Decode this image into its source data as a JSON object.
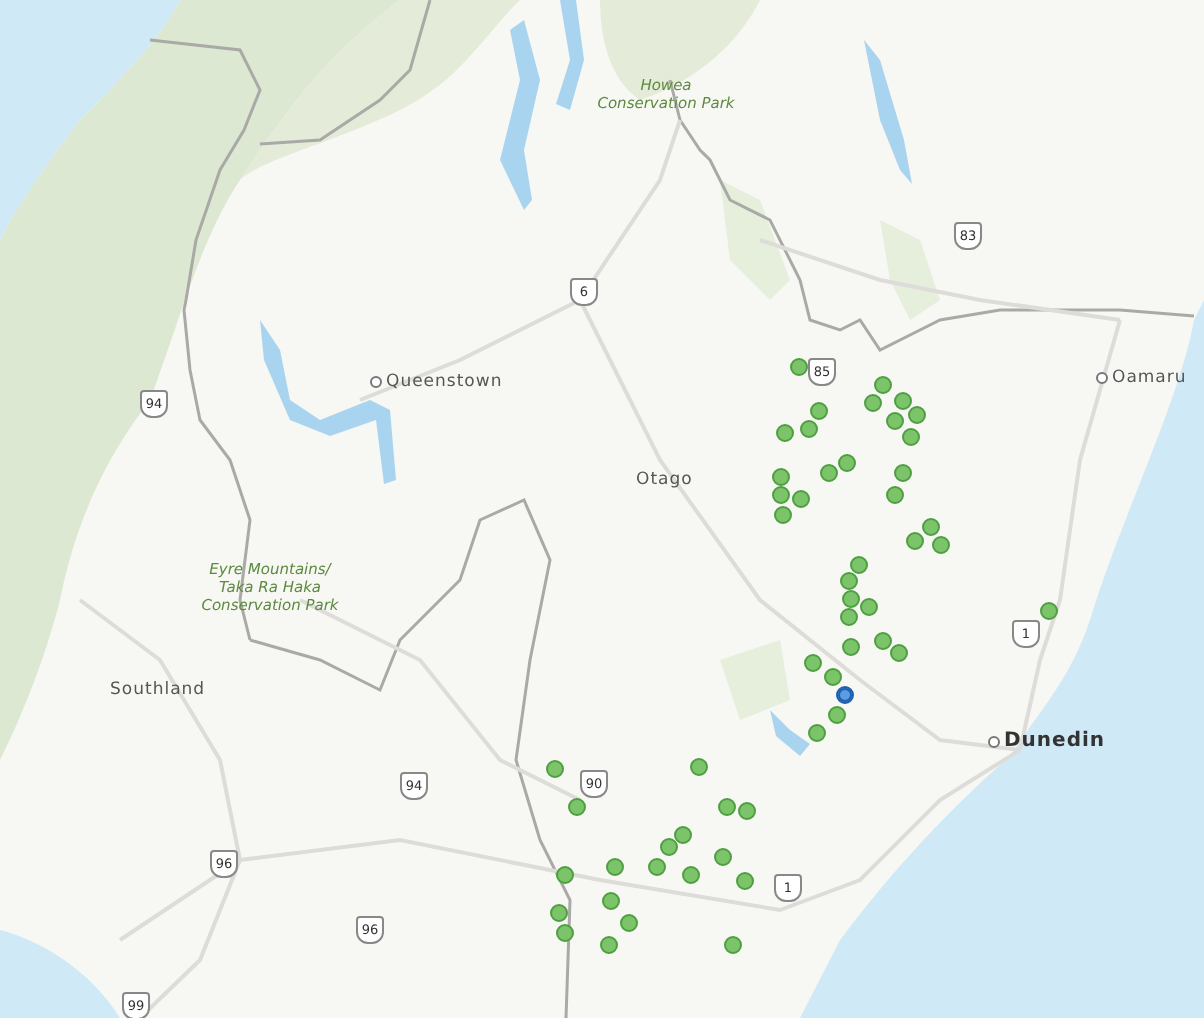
{
  "map": {
    "places": [
      {
        "name": "Queenstown",
        "kind": "town"
      },
      {
        "name": "Otago",
        "kind": "region"
      },
      {
        "name": "Oamaru",
        "kind": "town"
      },
      {
        "name": "Southland",
        "kind": "region"
      },
      {
        "name": "Dunedin",
        "kind": "city"
      },
      {
        "name": "Howea Conservation Park",
        "kind": "park"
      },
      {
        "name": "Eyre Mountains/ Taka Ra Haka Conservation Park",
        "kind": "park"
      }
    ],
    "shields": [
      "6",
      "94",
      "83",
      "85",
      "94",
      "90",
      "96",
      "96",
      "99",
      "1",
      "1"
    ],
    "markers": [
      {
        "selected": false
      },
      {
        "selected": false
      },
      {
        "selected": false
      },
      {
        "selected": false
      },
      {
        "selected": false
      },
      {
        "selected": false
      },
      {
        "selected": false
      },
      {
        "selected": false
      },
      {
        "selected": false
      },
      {
        "selected": false
      },
      {
        "selected": false
      },
      {
        "selected": false
      },
      {
        "selected": false
      },
      {
        "selected": false
      },
      {
        "selected": false
      },
      {
        "selected": false
      },
      {
        "selected": false
      },
      {
        "selected": false
      },
      {
        "selected": false
      },
      {
        "selected": false
      },
      {
        "selected": false
      },
      {
        "selected": false
      },
      {
        "selected": false
      },
      {
        "selected": false
      },
      {
        "selected": false
      },
      {
        "selected": false
      },
      {
        "selected": false
      },
      {
        "selected": false
      },
      {
        "selected": false
      },
      {
        "selected": false
      },
      {
        "selected": false
      },
      {
        "selected": true
      },
      {
        "selected": false
      },
      {
        "selected": false
      },
      {
        "selected": false
      },
      {
        "selected": false
      },
      {
        "selected": false
      },
      {
        "selected": false
      },
      {
        "selected": false
      },
      {
        "selected": false
      },
      {
        "selected": false
      },
      {
        "selected": false
      },
      {
        "selected": false
      },
      {
        "selected": false
      },
      {
        "selected": false
      },
      {
        "selected": false
      },
      {
        "selected": false
      },
      {
        "selected": false
      },
      {
        "selected": false
      },
      {
        "selected": false
      },
      {
        "selected": false
      },
      {
        "selected": false
      },
      {
        "selected": false
      },
      {
        "selected": false
      }
    ]
  }
}
